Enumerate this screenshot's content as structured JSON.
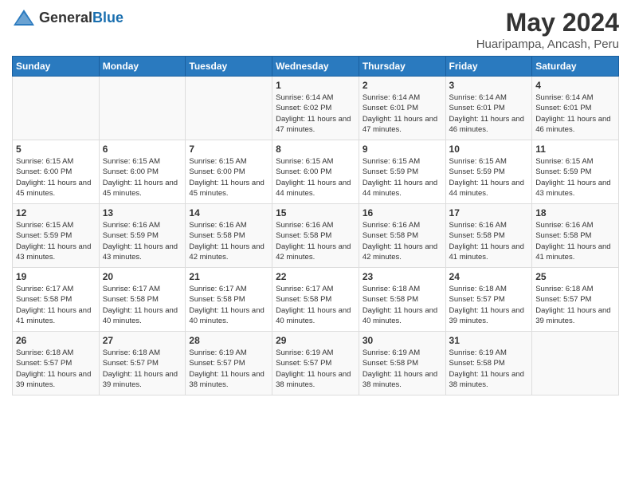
{
  "header": {
    "logo_general": "General",
    "logo_blue": "Blue",
    "month_title": "May 2024",
    "location": "Huaripampa, Ancash, Peru"
  },
  "weekdays": [
    "Sunday",
    "Monday",
    "Tuesday",
    "Wednesday",
    "Thursday",
    "Friday",
    "Saturday"
  ],
  "weeks": [
    [
      {
        "day": "",
        "sunrise": "",
        "sunset": "",
        "daylight": ""
      },
      {
        "day": "",
        "sunrise": "",
        "sunset": "",
        "daylight": ""
      },
      {
        "day": "",
        "sunrise": "",
        "sunset": "",
        "daylight": ""
      },
      {
        "day": "1",
        "sunrise": "Sunrise: 6:14 AM",
        "sunset": "Sunset: 6:02 PM",
        "daylight": "Daylight: 11 hours and 47 minutes."
      },
      {
        "day": "2",
        "sunrise": "Sunrise: 6:14 AM",
        "sunset": "Sunset: 6:01 PM",
        "daylight": "Daylight: 11 hours and 47 minutes."
      },
      {
        "day": "3",
        "sunrise": "Sunrise: 6:14 AM",
        "sunset": "Sunset: 6:01 PM",
        "daylight": "Daylight: 11 hours and 46 minutes."
      },
      {
        "day": "4",
        "sunrise": "Sunrise: 6:14 AM",
        "sunset": "Sunset: 6:01 PM",
        "daylight": "Daylight: 11 hours and 46 minutes."
      }
    ],
    [
      {
        "day": "5",
        "sunrise": "Sunrise: 6:15 AM",
        "sunset": "Sunset: 6:00 PM",
        "daylight": "Daylight: 11 hours and 45 minutes."
      },
      {
        "day": "6",
        "sunrise": "Sunrise: 6:15 AM",
        "sunset": "Sunset: 6:00 PM",
        "daylight": "Daylight: 11 hours and 45 minutes."
      },
      {
        "day": "7",
        "sunrise": "Sunrise: 6:15 AM",
        "sunset": "Sunset: 6:00 PM",
        "daylight": "Daylight: 11 hours and 45 minutes."
      },
      {
        "day": "8",
        "sunrise": "Sunrise: 6:15 AM",
        "sunset": "Sunset: 6:00 PM",
        "daylight": "Daylight: 11 hours and 44 minutes."
      },
      {
        "day": "9",
        "sunrise": "Sunrise: 6:15 AM",
        "sunset": "Sunset: 5:59 PM",
        "daylight": "Daylight: 11 hours and 44 minutes."
      },
      {
        "day": "10",
        "sunrise": "Sunrise: 6:15 AM",
        "sunset": "Sunset: 5:59 PM",
        "daylight": "Daylight: 11 hours and 44 minutes."
      },
      {
        "day": "11",
        "sunrise": "Sunrise: 6:15 AM",
        "sunset": "Sunset: 5:59 PM",
        "daylight": "Daylight: 11 hours and 43 minutes."
      }
    ],
    [
      {
        "day": "12",
        "sunrise": "Sunrise: 6:15 AM",
        "sunset": "Sunset: 5:59 PM",
        "daylight": "Daylight: 11 hours and 43 minutes."
      },
      {
        "day": "13",
        "sunrise": "Sunrise: 6:16 AM",
        "sunset": "Sunset: 5:59 PM",
        "daylight": "Daylight: 11 hours and 43 minutes."
      },
      {
        "day": "14",
        "sunrise": "Sunrise: 6:16 AM",
        "sunset": "Sunset: 5:58 PM",
        "daylight": "Daylight: 11 hours and 42 minutes."
      },
      {
        "day": "15",
        "sunrise": "Sunrise: 6:16 AM",
        "sunset": "Sunset: 5:58 PM",
        "daylight": "Daylight: 11 hours and 42 minutes."
      },
      {
        "day": "16",
        "sunrise": "Sunrise: 6:16 AM",
        "sunset": "Sunset: 5:58 PM",
        "daylight": "Daylight: 11 hours and 42 minutes."
      },
      {
        "day": "17",
        "sunrise": "Sunrise: 6:16 AM",
        "sunset": "Sunset: 5:58 PM",
        "daylight": "Daylight: 11 hours and 41 minutes."
      },
      {
        "day": "18",
        "sunrise": "Sunrise: 6:16 AM",
        "sunset": "Sunset: 5:58 PM",
        "daylight": "Daylight: 11 hours and 41 minutes."
      }
    ],
    [
      {
        "day": "19",
        "sunrise": "Sunrise: 6:17 AM",
        "sunset": "Sunset: 5:58 PM",
        "daylight": "Daylight: 11 hours and 41 minutes."
      },
      {
        "day": "20",
        "sunrise": "Sunrise: 6:17 AM",
        "sunset": "Sunset: 5:58 PM",
        "daylight": "Daylight: 11 hours and 40 minutes."
      },
      {
        "day": "21",
        "sunrise": "Sunrise: 6:17 AM",
        "sunset": "Sunset: 5:58 PM",
        "daylight": "Daylight: 11 hours and 40 minutes."
      },
      {
        "day": "22",
        "sunrise": "Sunrise: 6:17 AM",
        "sunset": "Sunset: 5:58 PM",
        "daylight": "Daylight: 11 hours and 40 minutes."
      },
      {
        "day": "23",
        "sunrise": "Sunrise: 6:18 AM",
        "sunset": "Sunset: 5:58 PM",
        "daylight": "Daylight: 11 hours and 40 minutes."
      },
      {
        "day": "24",
        "sunrise": "Sunrise: 6:18 AM",
        "sunset": "Sunset: 5:57 PM",
        "daylight": "Daylight: 11 hours and 39 minutes."
      },
      {
        "day": "25",
        "sunrise": "Sunrise: 6:18 AM",
        "sunset": "Sunset: 5:57 PM",
        "daylight": "Daylight: 11 hours and 39 minutes."
      }
    ],
    [
      {
        "day": "26",
        "sunrise": "Sunrise: 6:18 AM",
        "sunset": "Sunset: 5:57 PM",
        "daylight": "Daylight: 11 hours and 39 minutes."
      },
      {
        "day": "27",
        "sunrise": "Sunrise: 6:18 AM",
        "sunset": "Sunset: 5:57 PM",
        "daylight": "Daylight: 11 hours and 39 minutes."
      },
      {
        "day": "28",
        "sunrise": "Sunrise: 6:19 AM",
        "sunset": "Sunset: 5:57 PM",
        "daylight": "Daylight: 11 hours and 38 minutes."
      },
      {
        "day": "29",
        "sunrise": "Sunrise: 6:19 AM",
        "sunset": "Sunset: 5:57 PM",
        "daylight": "Daylight: 11 hours and 38 minutes."
      },
      {
        "day": "30",
        "sunrise": "Sunrise: 6:19 AM",
        "sunset": "Sunset: 5:58 PM",
        "daylight": "Daylight: 11 hours and 38 minutes."
      },
      {
        "day": "31",
        "sunrise": "Sunrise: 6:19 AM",
        "sunset": "Sunset: 5:58 PM",
        "daylight": "Daylight: 11 hours and 38 minutes."
      },
      {
        "day": "",
        "sunrise": "",
        "sunset": "",
        "daylight": ""
      }
    ]
  ]
}
